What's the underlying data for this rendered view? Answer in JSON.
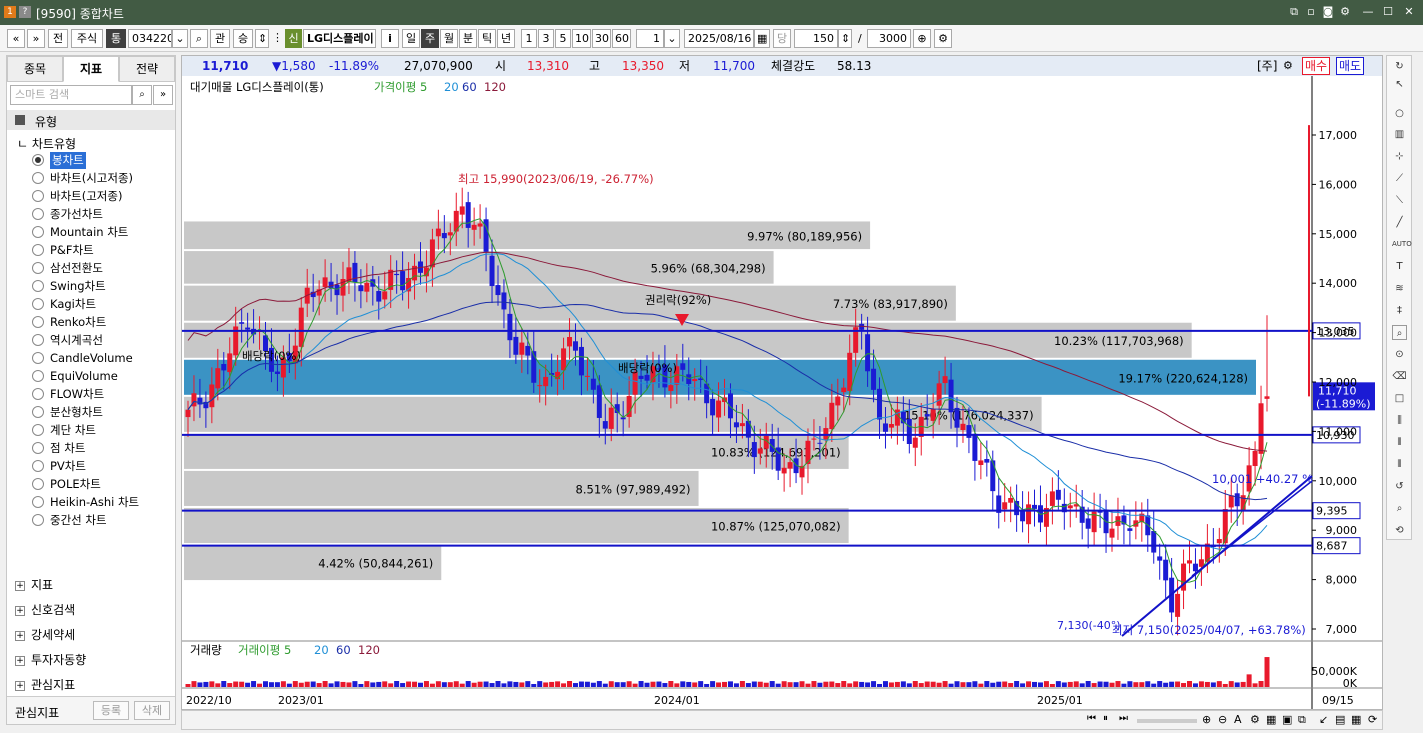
{
  "window": {
    "title": "[9590] 종합차트"
  },
  "toolbar": {
    "nav_prev": "«",
    "nav_down": "»",
    "btn_jeon": "전",
    "btn_stock": "주식",
    "btn_tong": "통",
    "code": "034220",
    "btn_gwan": "관",
    "btn_seung": "승",
    "badge_shin": "신",
    "stock_name": "LG디스플레이",
    "btn_info": "i",
    "periods": [
      "일",
      "주",
      "월",
      "분",
      "틱",
      "년"
    ],
    "active_period": "주",
    "intervals": [
      "1",
      "3",
      "5",
      "10",
      "30",
      "60"
    ],
    "interval_value": "1",
    "date": "2025/08/16",
    "dang": "당",
    "count": "150",
    "slash": "/",
    "total": "3000"
  },
  "left_panel": {
    "tabs": [
      "종목",
      "지표",
      "전략"
    ],
    "active_tab": "지표",
    "search_placeholder": "스마트 검색",
    "section_type": "유형",
    "chart_type_header": "차트유형",
    "chart_types": [
      "봉차트",
      "바차트(시고저종)",
      "바차트(고저종)",
      "종가선차트",
      "Mountain 차트",
      "P&F차트",
      "삼선전환도",
      "Swing차트",
      "Kagi차트",
      "Renko차트",
      "역시계곡선",
      "CandleVolume",
      "EquiVolume",
      "FLOW차트",
      "분산형차트",
      "계단 차트",
      "점 차트",
      "PV차트",
      "POLE차트",
      "Heikin-Ashi 차트",
      "중간선 차트"
    ],
    "selected_chart_type": "봉차트",
    "sections": [
      "지표",
      "신호검색",
      "강세약세",
      "투자자동향",
      "관심지표"
    ],
    "footer_label": "관심지표",
    "footer_btn_register": "등록",
    "footer_btn_delete": "삭제"
  },
  "quote": {
    "price": "11,710",
    "change": "▼1,580",
    "change_pct": "-11.89%",
    "volume": "27,070,900",
    "open_label": "시",
    "open": "13,310",
    "high_label": "고",
    "high": "13,350",
    "low_label": "저",
    "low": "11,700",
    "strength_label": "체결강도",
    "strength": "58.13",
    "unit": "[주]",
    "buy": "매수",
    "sell": "매도"
  },
  "colors": {
    "up": "#e8192c",
    "down": "#1b1bd4",
    "ma5": "#2e9b2e",
    "ma20": "#1f8fd6",
    "ma60": "#1a2ea8",
    "ma120": "#8b1a3a",
    "hline": "#1212c8",
    "profile": "#c8c8c8",
    "profile_hi": "#3b93c4"
  },
  "chart_data": {
    "type": "candlestick",
    "title": "대기매물 LG디스플레이(통)",
    "legend": [
      "가격이평 5",
      "20",
      "60",
      "120"
    ],
    "volume_legend": [
      "거래량",
      "거래이평 5",
      "20",
      "60",
      "120"
    ],
    "x_ticks": [
      "2022/10",
      "2023/01",
      "2024/01",
      "2025/01",
      "09/15"
    ],
    "y_ticks": [
      "17,000",
      "16,000",
      "15,000",
      "14,000",
      "13,000",
      "12,000",
      "11,000",
      "10,000",
      "9,000",
      "8,000",
      "7,000"
    ],
    "volume_ticks": [
      "50,000K",
      "0K"
    ],
    "ylim": [
      6900,
      17800
    ],
    "current_price": "11,710",
    "current_pct": "(-11.89%)",
    "price_levels": [
      {
        "label": "13,035",
        "value": 13035
      },
      {
        "label": "10,930",
        "value": 10930
      },
      {
        "label": "9,395",
        "value": 9395
      },
      {
        "label": "8,687",
        "value": 8687
      }
    ],
    "volume_profile": [
      {
        "low": 14650,
        "high": 15250,
        "pct": "9.97%",
        "vol": "80,189,956",
        "text": "9.97% (80,189,956)",
        "rel": 0.64
      },
      {
        "low": 13950,
        "high": 14650,
        "pct": "5.96%",
        "vol": "68,304,298",
        "text": "5.96% (68,304,298)",
        "rel": 0.55
      },
      {
        "low": 13200,
        "high": 13950,
        "pct": "7.73%",
        "vol": "83,917,890",
        "text": "7.73% (83,917,890)",
        "rel": 0.72
      },
      {
        "low": 12450,
        "high": 13200,
        "pct": "10.23%",
        "vol": "117,703,968",
        "text": "10.23% (117,703,968)",
        "rel": 0.94
      },
      {
        "low": 11700,
        "high": 12450,
        "pct": "19.17%",
        "vol": "220,624,128",
        "text": "19.17% (220,624,128)",
        "rel": 1.0
      },
      {
        "low": 10950,
        "high": 11700,
        "pct": "15.10%",
        "vol": "176,024,337",
        "text": "15.10% (176,024,337)",
        "rel": 0.8
      },
      {
        "low": 10200,
        "high": 10950,
        "pct": "10.83%",
        "vol": "124,693,201",
        "text": "10.83% (124,693,201)",
        "rel": 0.62
      },
      {
        "low": 9450,
        "high": 10200,
        "pct": "8.51%",
        "vol": "97,989,492",
        "text": "8.51% (97,989,492)",
        "rel": 0.48
      },
      {
        "low": 8700,
        "high": 9450,
        "pct": "10.87%",
        "vol": "125,070,082",
        "text": "10.87% (125,070,082)",
        "rel": 0.62
      },
      {
        "low": 7950,
        "high": 8700,
        "pct": "4.42%",
        "vol": "50,844,261",
        "text": "4.42% (50,844,261)",
        "rel": 0.24
      }
    ],
    "annotations": {
      "high_marker": "최고 15,990(2023/06/19, -26.77%)",
      "high_value": 15990,
      "low_marker": "최저 7,150(2025/04/07, +63.78%)",
      "low_value": 7150,
      "rights": "권리락(92%)",
      "div1": "배당락(0%)",
      "div2": "배당락(0%)",
      "trend1": "10,001 +40.27 %",
      "trend2": "7,130(-40°)"
    }
  }
}
